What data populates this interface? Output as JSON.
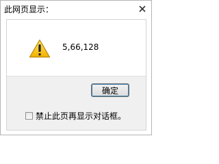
{
  "dialog": {
    "title": "此网页显示：",
    "close_icon": "close-icon",
    "message": "5,66,128",
    "message_icon": "warning-icon",
    "ok_label": "确定",
    "suppress_label": "禁止此页再显示对话框。",
    "suppress_checked": false
  }
}
